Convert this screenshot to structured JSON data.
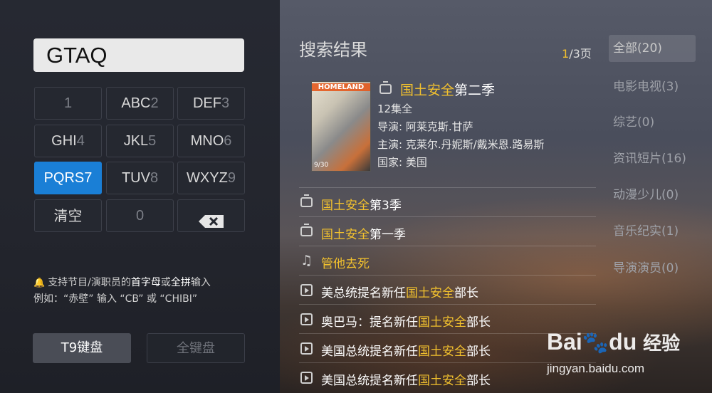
{
  "search": {
    "query": "GTAQ"
  },
  "keypad": {
    "keys": [
      {
        "letters": "",
        "digit": "1"
      },
      {
        "letters": "ABC",
        "digit": "2"
      },
      {
        "letters": "DEF",
        "digit": "3"
      },
      {
        "letters": "GHI",
        "digit": "4"
      },
      {
        "letters": "JKL",
        "digit": "5"
      },
      {
        "letters": "MNO",
        "digit": "6"
      },
      {
        "letters": "PQRS",
        "digit": "7"
      },
      {
        "letters": "TUV",
        "digit": "8"
      },
      {
        "letters": "WXYZ",
        "digit": "9"
      }
    ],
    "clear_label": "清空",
    "zero_label": "0",
    "backspace_icon": "backspace-icon"
  },
  "hint": {
    "line1_a": "支持节目/演职员的",
    "line1_b": "首字母",
    "line1_c": "或",
    "line1_d": "全拼",
    "line1_e": "输入",
    "line2": "例如：“赤壁” 输入 “CB” 或 “CHIBI”"
  },
  "keyboard_mode": {
    "t9_label": "T9键盘",
    "full_label": "全键盘"
  },
  "results": {
    "title": "搜索结果",
    "page_current": "1",
    "page_rest": "/3页",
    "featured": {
      "title_hl": "国土安全",
      "title_rest": "第二季",
      "episodes": "12集全",
      "director": "导演: 阿莱克斯.甘萨",
      "cast": "主演: 克莱尔.丹妮斯/戴米恩.路易斯",
      "country": "国家: 美国",
      "poster_title": "HOMELAND",
      "poster_date": "9/30"
    },
    "items": [
      {
        "icon": "tv-icon",
        "pre": "",
        "hl": "国土安全",
        "post": "第3季"
      },
      {
        "icon": "tv-icon",
        "pre": "",
        "hl": "国土安全",
        "post": "第一季"
      },
      {
        "icon": "music-icon",
        "pre": "",
        "hl": "管他去死",
        "post": ""
      },
      {
        "icon": "news-icon",
        "pre": "美总统提名新任",
        "hl": "国土安全",
        "post": "部长"
      },
      {
        "icon": "news-icon",
        "pre": "奥巴马：提名新任",
        "hl": "国土安全",
        "post": "部长"
      },
      {
        "icon": "news-icon",
        "pre": "美国总统提名新任",
        "hl": "国土安全",
        "post": "部长"
      },
      {
        "icon": "news-icon",
        "pre": "美国总统提名新任",
        "hl": "国土安全",
        "post": "部长"
      }
    ]
  },
  "categories": [
    {
      "label": "全部(20)"
    },
    {
      "label": "电影电视(3)"
    },
    {
      "label": "综艺(0)"
    },
    {
      "label": "资讯短片(16)"
    },
    {
      "label": "动漫少儿(0)"
    },
    {
      "label": "音乐纪实(1)"
    },
    {
      "label": "导演演员(0)"
    }
  ],
  "watermark": {
    "logo_a": "Bai",
    "logo_b": "du",
    "logo_c": "经验",
    "url": "jingyan.baidu.com"
  },
  "colors": {
    "accent": "#1a7fd6",
    "highlight": "#f2c12e"
  }
}
